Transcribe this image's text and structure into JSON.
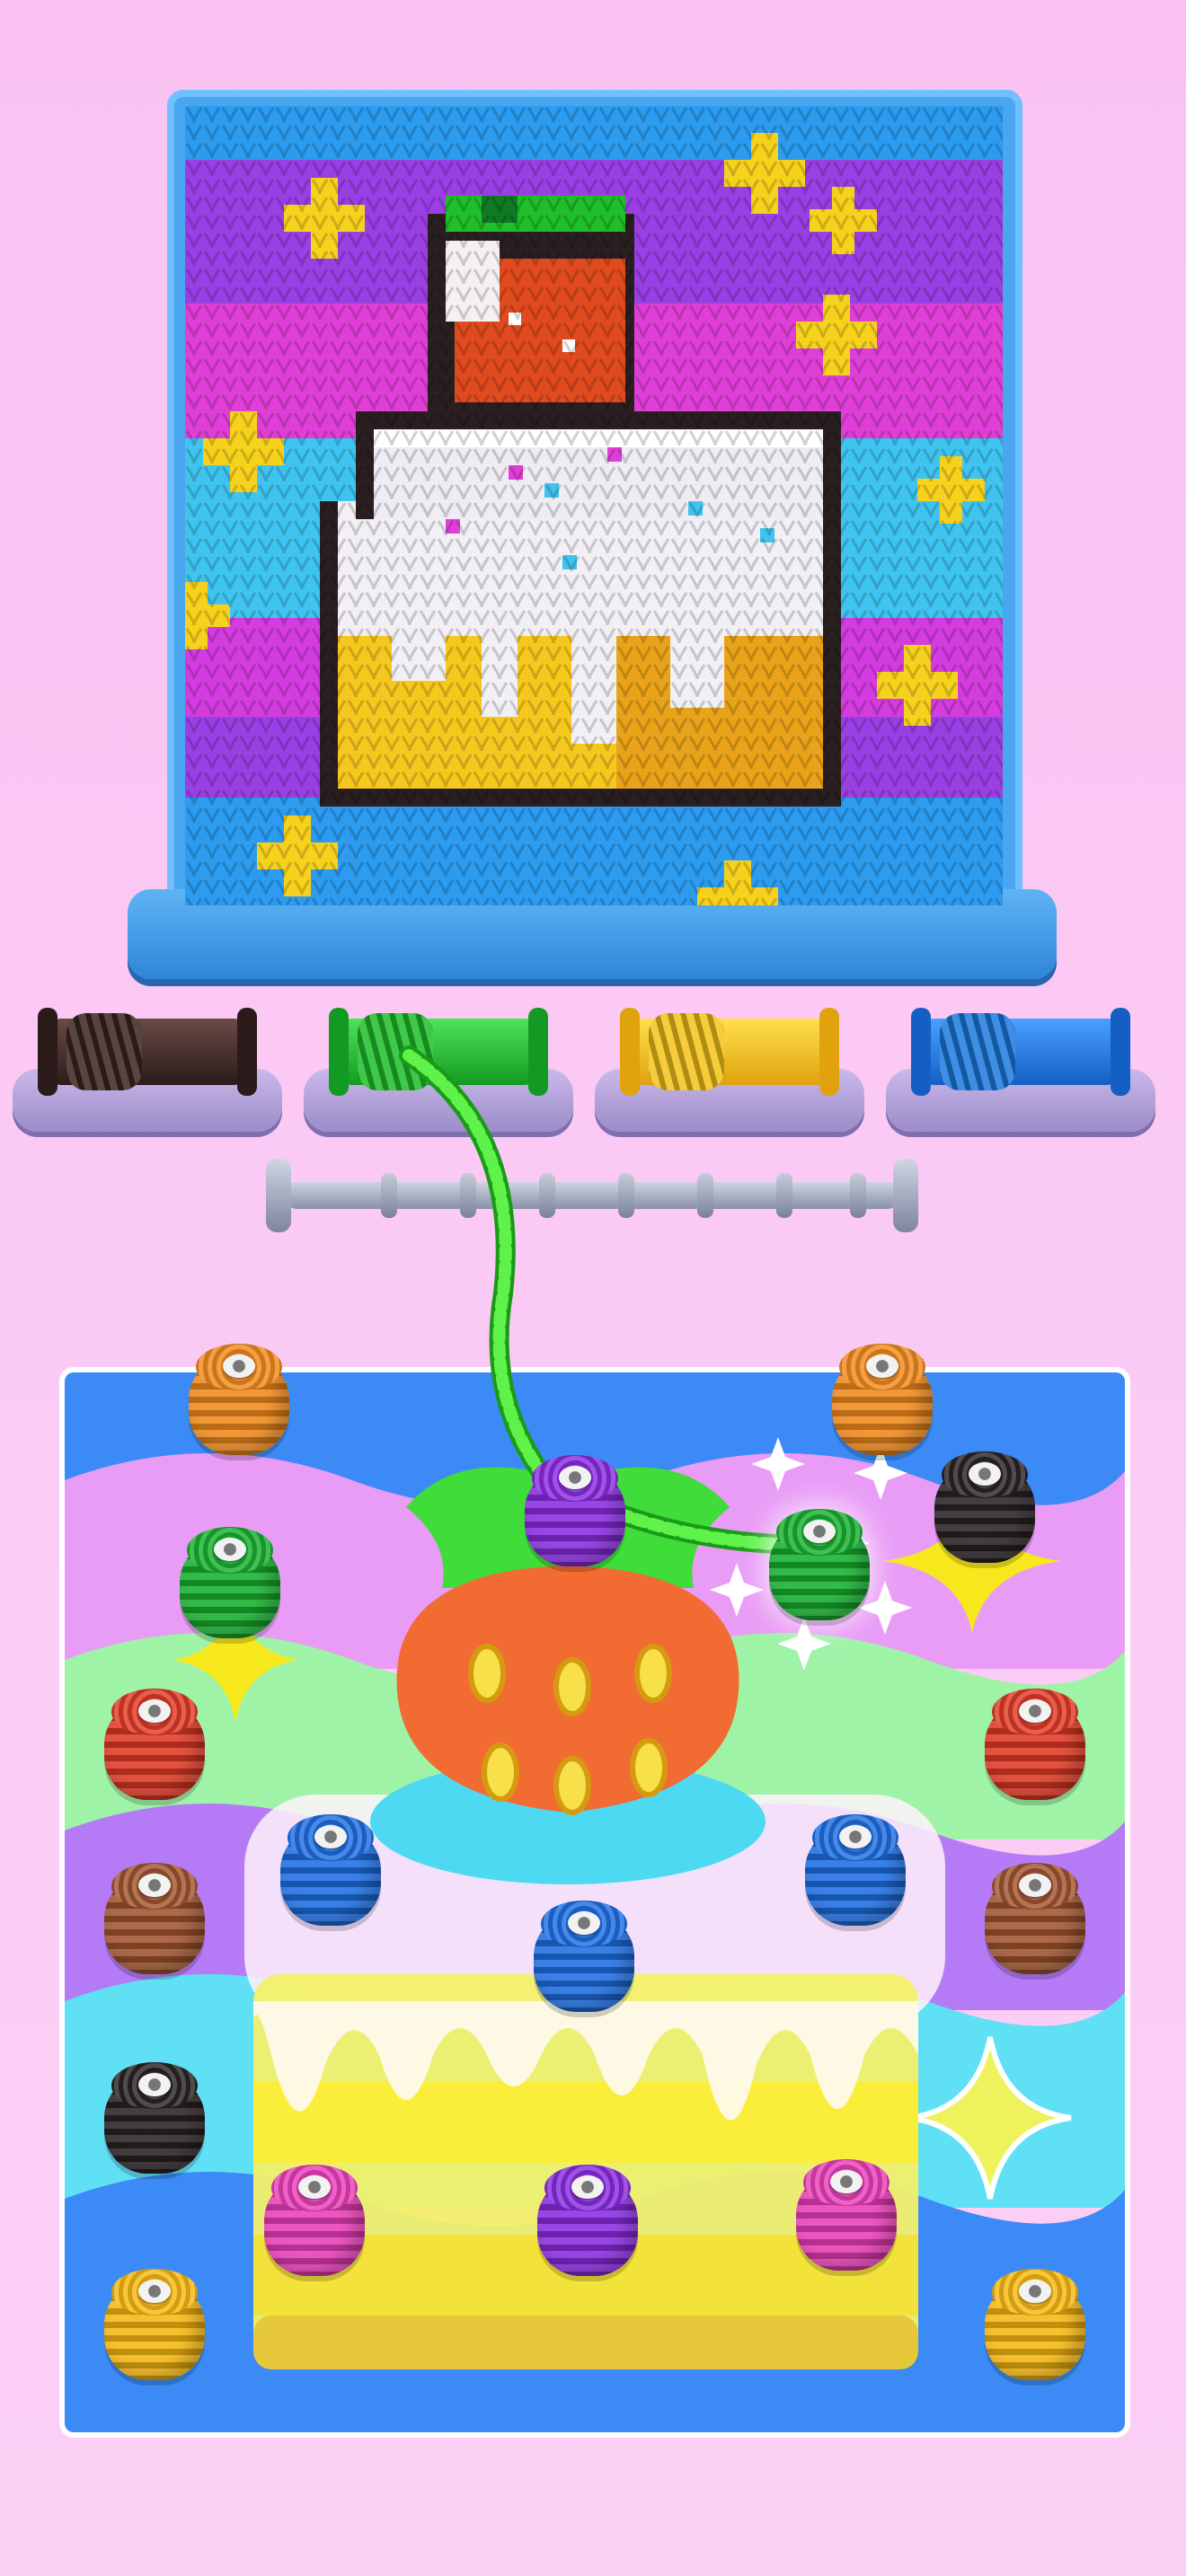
{
  "colors": {
    "background": "#fbc9f4",
    "board_blue": "#4aa6ef"
  },
  "spool_shelf": [
    {
      "color": "#3b2421",
      "name": "dark-brown"
    },
    {
      "color": "#1fbf2a",
      "name": "green",
      "active": true
    },
    {
      "color": "#f4c21a",
      "name": "yellow"
    },
    {
      "color": "#1d7ae0",
      "name": "blue"
    }
  ],
  "rail_slots": 7,
  "thread_spools": [
    {
      "id": "orange-1",
      "color": "#f08a1e"
    },
    {
      "id": "orange-2",
      "color": "#f08a1e"
    },
    {
      "id": "purple-top",
      "color": "#8a2de0"
    },
    {
      "id": "black-1",
      "color": "#2a2326"
    },
    {
      "id": "green-1",
      "color": "#18b030"
    },
    {
      "id": "green-selected",
      "color": "#18b030"
    },
    {
      "id": "red-1",
      "color": "#e03a26"
    },
    {
      "id": "red-2",
      "color": "#e03a26"
    },
    {
      "id": "blue-1",
      "color": "#1f6fe3"
    },
    {
      "id": "blue-2",
      "color": "#1f6fe3"
    },
    {
      "id": "blue-3",
      "color": "#1f6fe3"
    },
    {
      "id": "brown-1",
      "color": "#a05530"
    },
    {
      "id": "brown-2",
      "color": "#a05530"
    },
    {
      "id": "black-2",
      "color": "#2a2326"
    },
    {
      "id": "pink-1",
      "color": "#e93fb8"
    },
    {
      "id": "purple-2",
      "color": "#8a2de0"
    },
    {
      "id": "pink-2",
      "color": "#e93fb8"
    },
    {
      "id": "yellow-1",
      "color": "#f7b812"
    },
    {
      "id": "yellow-2",
      "color": "#f7b812"
    }
  ]
}
